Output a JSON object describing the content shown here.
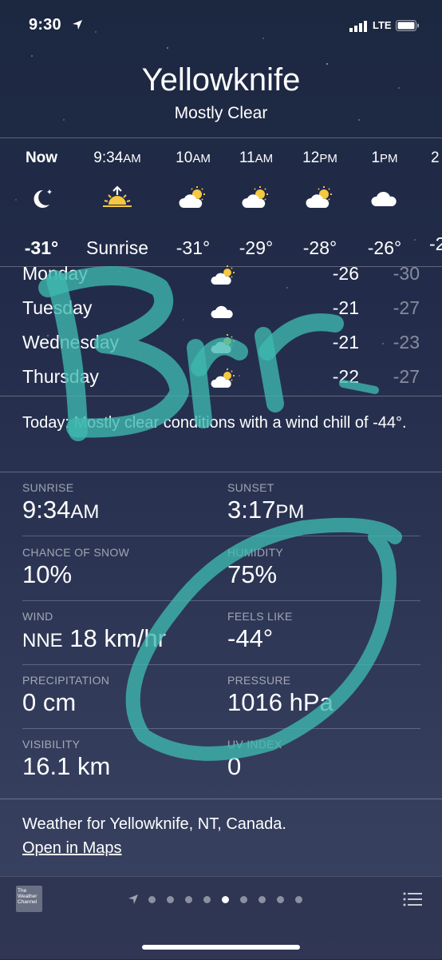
{
  "status_bar": {
    "time": "9:30",
    "network": "LTE",
    "icons": [
      "location-arrow-icon",
      "signal-icon",
      "battery-icon"
    ]
  },
  "location": {
    "city": "Yellowknife",
    "condition": "Mostly Clear"
  },
  "hourly": [
    {
      "time": "Now",
      "ampm": "",
      "icon": "moon-stars-icon",
      "temp": "-31°"
    },
    {
      "time": "9:34",
      "ampm": "AM",
      "icon": "sunrise-icon",
      "temp": "Sunrise"
    },
    {
      "time": "10",
      "ampm": "AM",
      "icon": "partly-cloudy-sun-icon",
      "temp": "-31°"
    },
    {
      "time": "11",
      "ampm": "AM",
      "icon": "partly-cloudy-sun-icon",
      "temp": "-29°"
    },
    {
      "time": "12",
      "ampm": "PM",
      "icon": "partly-cloudy-sun-icon",
      "temp": "-28°"
    },
    {
      "time": "1",
      "ampm": "PM",
      "icon": "cloud-icon",
      "temp": "-26°"
    },
    {
      "time": "2",
      "ampm": "",
      "icon": "",
      "temp": "-2"
    }
  ],
  "daily": [
    {
      "day": "Monday",
      "icon": "partly-cloudy-sun-icon",
      "high": "-26",
      "low": "-30"
    },
    {
      "day": "Tuesday",
      "icon": "cloud-icon",
      "high": "-21",
      "low": "-27"
    },
    {
      "day": "Wednesday",
      "icon": "partly-cloudy-sun-icon",
      "high": "-21",
      "low": "-23"
    },
    {
      "day": "Thursday",
      "icon": "partly-cloudy-sun-icon",
      "high": "-22",
      "low": "-27"
    }
  ],
  "summary": "Today: Mostly clear conditions with a wind chill of -44°.",
  "details": {
    "sunrise": {
      "label": "SUNRISE",
      "value": "9:34",
      "unit": "AM"
    },
    "sunset": {
      "label": "SUNSET",
      "value": "3:17",
      "unit": "PM"
    },
    "chance_of_snow": {
      "label": "CHANCE OF SNOW",
      "value": "10%"
    },
    "humidity": {
      "label": "HUMIDITY",
      "value": "75%"
    },
    "wind": {
      "label": "WIND",
      "dir": "NNE",
      "value": "18 km/hr"
    },
    "feels_like": {
      "label": "FEELS LIKE",
      "value": "-44°"
    },
    "precipitation": {
      "label": "PRECIPITATION",
      "value": "0 cm"
    },
    "pressure": {
      "label": "PRESSURE",
      "value": "1016 hPa"
    },
    "visibility": {
      "label": "VISIBILITY",
      "value": "16.1 km"
    },
    "uv_index": {
      "label": "UV INDEX",
      "value": "0"
    }
  },
  "footer": {
    "weather_for": "Weather for Yellowknife, NT, Canada.",
    "open_in_maps": "Open in Maps",
    "logo_text": "The Weather Channel"
  },
  "pager": {
    "total_dots": 9,
    "active_index": 4
  },
  "annotation": {
    "handwritten_text": "Brr",
    "ink_color": "#3fb8b0"
  }
}
